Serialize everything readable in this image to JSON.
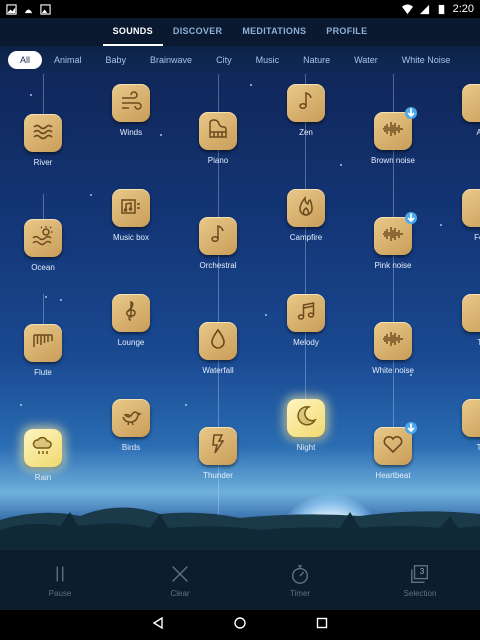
{
  "status": {
    "time": "2:20"
  },
  "tabs": [
    {
      "label": "SOUNDS",
      "active": true
    },
    {
      "label": "DISCOVER",
      "active": false
    },
    {
      "label": "MEDITATIONS",
      "active": false
    },
    {
      "label": "PROFILE",
      "active": false
    }
  ],
  "categories": [
    {
      "label": "All",
      "active": true
    },
    {
      "label": "Animal"
    },
    {
      "label": "Baby"
    },
    {
      "label": "Brainwave"
    },
    {
      "label": "City"
    },
    {
      "label": "Music"
    },
    {
      "label": "Nature"
    },
    {
      "label": "Water"
    },
    {
      "label": "White Noise"
    }
  ],
  "sounds": {
    "river": {
      "label": "River",
      "icon": "waves-icon"
    },
    "ocean": {
      "label": "Ocean",
      "icon": "sun-waves-icon"
    },
    "flute": {
      "label": "Flute",
      "icon": "flute-icon"
    },
    "rain": {
      "label": "Rain",
      "icon": "rain-cloud-icon",
      "active": true
    },
    "winds": {
      "label": "Winds",
      "icon": "wind-icon"
    },
    "music_box": {
      "label": "Music box",
      "icon": "music-box-icon"
    },
    "lounge": {
      "label": "Lounge",
      "icon": "treble-clef-icon"
    },
    "birds": {
      "label": "Birds",
      "icon": "bird-icon"
    },
    "piano": {
      "label": "Piano",
      "icon": "piano-icon"
    },
    "orchestral": {
      "label": "Orchestral",
      "icon": "music-note-icon"
    },
    "waterfall": {
      "label": "Waterfall",
      "icon": "water-drop-icon"
    },
    "thunder": {
      "label": "Thunder",
      "icon": "lightning-icon"
    },
    "zen": {
      "label": "Zen",
      "icon": "music-note-icon"
    },
    "campfire": {
      "label": "Campfire",
      "icon": "flame-icon"
    },
    "melody": {
      "label": "Melody",
      "icon": "double-note-icon"
    },
    "night": {
      "label": "Night",
      "icon": "moon-icon",
      "active": true
    },
    "brown_noise": {
      "label": "Brown noise",
      "icon": "sound-wave-icon",
      "download": true
    },
    "pink_noise": {
      "label": "Pink noise",
      "icon": "sound-wave-icon",
      "download": true
    },
    "white_noise": {
      "label": "White noise",
      "icon": "sound-wave-icon"
    },
    "heartbeat": {
      "label": "Heartbeat",
      "icon": "heart-icon",
      "download": true
    },
    "col6_r1": {
      "label": "As"
    },
    "col6_r2": {
      "label": "Fou"
    },
    "col6_r3": {
      "label": "Tr"
    },
    "col6_r4": {
      "label": "Tri"
    }
  },
  "controls": {
    "pause": "Pause",
    "clear": "Clear",
    "timer": "Timer",
    "selection": "Selection",
    "selection_count": "3"
  },
  "colors": {
    "accent_active": "#f0d870",
    "tile": "#d9b36e",
    "download": "#4aa8ee"
  }
}
